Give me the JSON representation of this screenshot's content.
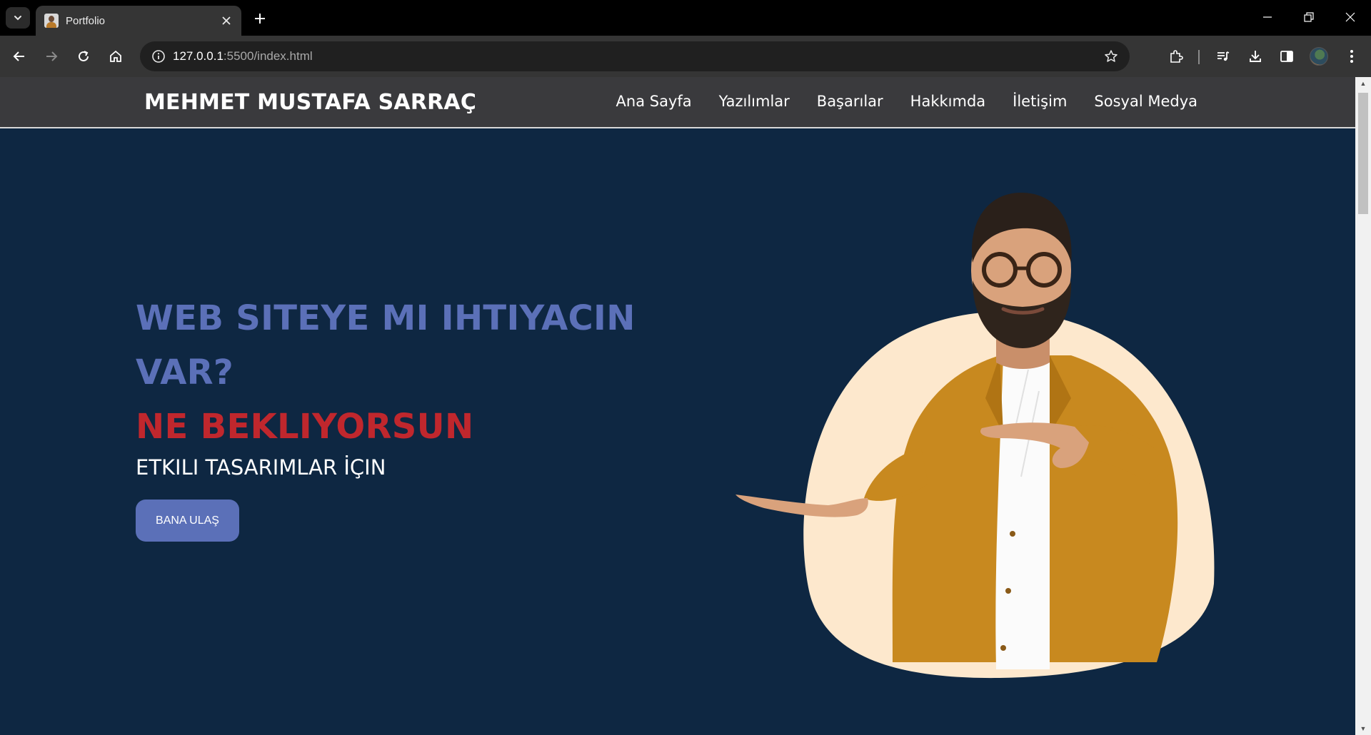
{
  "browser": {
    "tab_title": "Portfolio",
    "url_host": "127.0.0.1",
    "url_path": ":5500/index.html"
  },
  "site": {
    "logo": "MEHMET MUSTAFA SARRAÇ",
    "nav": [
      "Ana Sayfa",
      "Yazılımlar",
      "Başarılar",
      "Hakkımda",
      "İletişim",
      "Sosyal Medya"
    ]
  },
  "hero": {
    "line1a": "WEB SITEYE MI IHTIYACIN",
    "line1b": "VAR?",
    "line2": "NE BEKLIYORSUN",
    "subtitle": "ETKILI TASARIMLAR İÇIN",
    "cta": "BANA ULAŞ"
  },
  "colors": {
    "page_bg": "#0e2742",
    "accent_blue": "#5b70b8",
    "accent_red": "#c0272d",
    "header_bg": "#3a3a3d"
  }
}
